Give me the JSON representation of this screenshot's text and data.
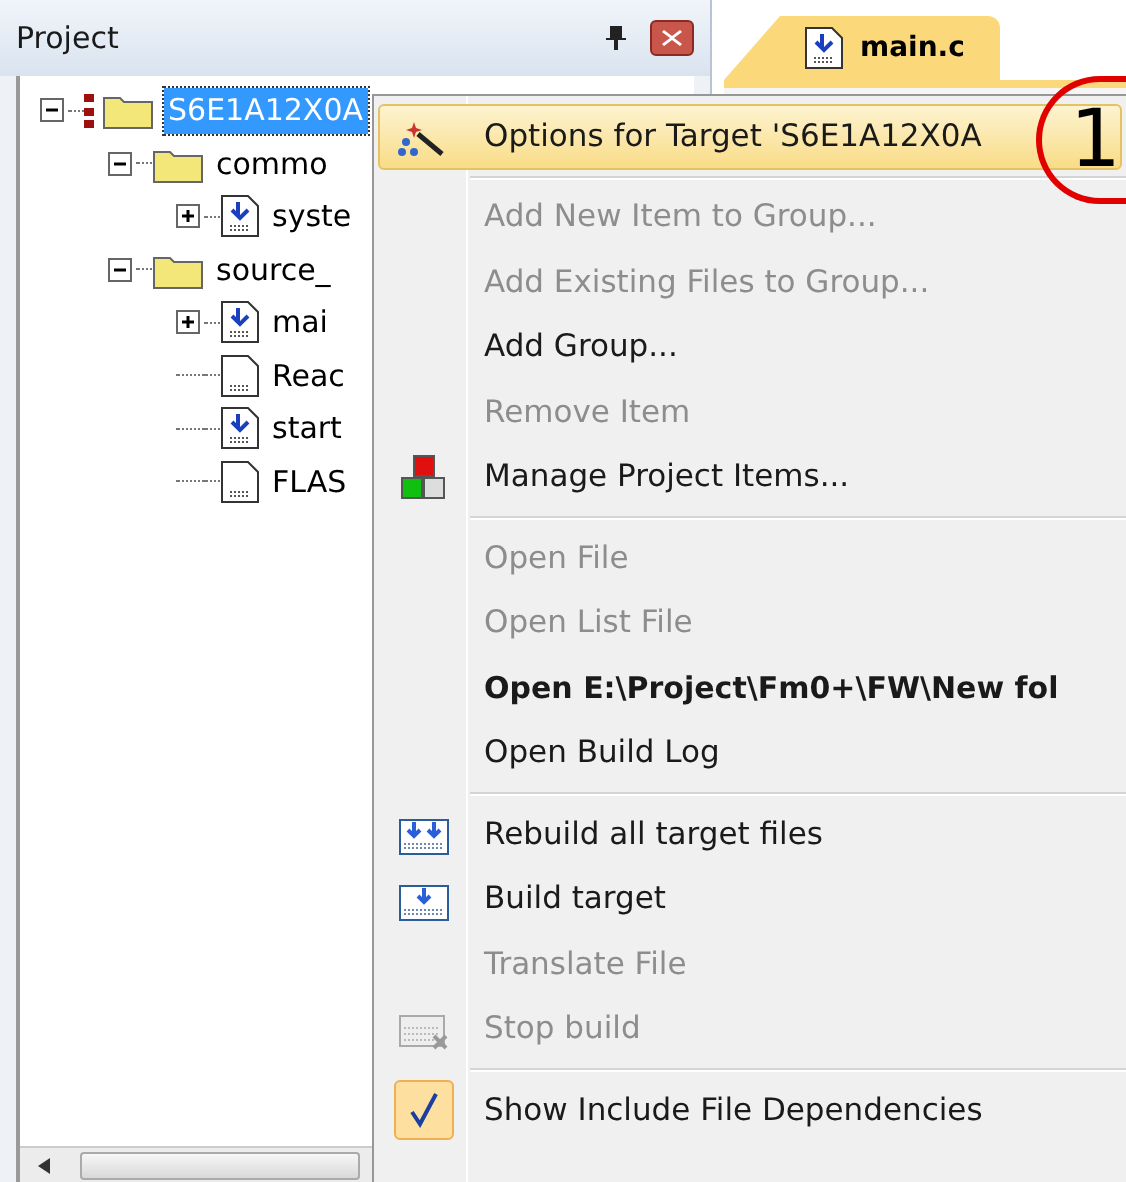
{
  "panel": {
    "title": "Project"
  },
  "tree": [
    {
      "label": "S6E1A12X0A",
      "kind": "target",
      "expanded": true,
      "selected": true,
      "children": [
        {
          "label": "commo",
          "kind": "folder",
          "expanded": true,
          "selected": false,
          "children": [
            {
              "label": "syste",
              "kind": "source",
              "expanded": false,
              "selected": false
            }
          ]
        },
        {
          "label": "source_",
          "kind": "folder",
          "expanded": true,
          "selected": false,
          "children": [
            {
              "label": "mai",
              "kind": "source",
              "expanded": false,
              "selected": false
            },
            {
              "label": "Reac",
              "kind": "text",
              "selected": false
            },
            {
              "label": "start",
              "kind": "source",
              "selected": false
            },
            {
              "label": "FLAS",
              "kind": "text",
              "selected": false
            }
          ]
        }
      ]
    }
  ],
  "tabs": [
    {
      "label": "main.c",
      "selected": true
    }
  ],
  "annotation": "1",
  "menu": [
    {
      "label": "Options for Target 'S6E1A12X0A",
      "kind": "wand",
      "disabled": false,
      "selected": true
    },
    {
      "kind": "separator"
    },
    {
      "label": "Add New Item to Group...",
      "disabled": true,
      "selected": false
    },
    {
      "label": "Add Existing Files to Group...",
      "disabled": true,
      "selected": false
    },
    {
      "label": "Add Group...",
      "disabled": false,
      "selected": false
    },
    {
      "label": "Remove Item",
      "disabled": true,
      "selected": false
    },
    {
      "label": "Manage Project Items...",
      "kind": "blocks",
      "disabled": false,
      "selected": false
    },
    {
      "kind": "separator"
    },
    {
      "label": "Open File",
      "disabled": true,
      "selected": false
    },
    {
      "label": "Open List File",
      "disabled": true,
      "selected": false
    },
    {
      "label": "Open E:\\Project\\Fm0+\\FW\\New fol",
      "bold": true,
      "disabled": false,
      "selected": false
    },
    {
      "label": "Open Build Log",
      "disabled": false,
      "selected": false
    },
    {
      "kind": "separator"
    },
    {
      "label": "Rebuild all target files",
      "kind": "rebuild",
      "disabled": false,
      "selected": false
    },
    {
      "label": "Build target",
      "kind": "build",
      "disabled": false,
      "selected": false
    },
    {
      "label": "Translate File",
      "disabled": true,
      "selected": false
    },
    {
      "label": "Stop build",
      "kind": "stop",
      "disabled": true,
      "selected": false
    },
    {
      "kind": "separator"
    },
    {
      "label": "Show Include File Dependencies",
      "disabled": false,
      "selected": false,
      "checked": true
    }
  ]
}
